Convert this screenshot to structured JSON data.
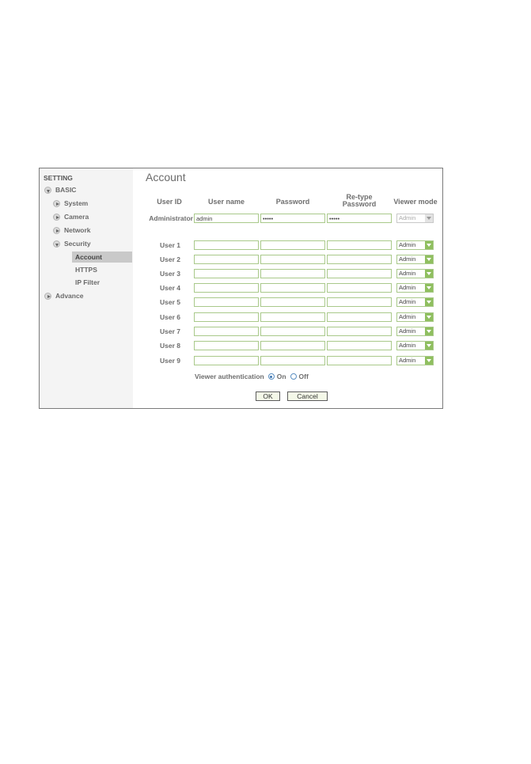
{
  "sidebar": {
    "title": "SETTING",
    "items": [
      {
        "label": "BASIC"
      },
      {
        "label": "System"
      },
      {
        "label": "Camera"
      },
      {
        "label": "Network"
      },
      {
        "label": "Security"
      },
      {
        "label": "Account"
      },
      {
        "label": "HTTPS"
      },
      {
        "label": "IP Filter"
      },
      {
        "label": "Advance"
      }
    ]
  },
  "main": {
    "title": "Account",
    "headers": {
      "user_id": "User ID",
      "user_name": "User name",
      "password": "Password",
      "retype_line1": "Re-type",
      "retype_line2": "Password",
      "viewer_mode": "Viewer mode"
    },
    "admin": {
      "label": "Administrator",
      "user_name": "admin",
      "password": "•••••",
      "retype": "•••••",
      "viewer_mode": "Admin"
    },
    "users": [
      {
        "label": "User 1",
        "viewer_mode": "Admin"
      },
      {
        "label": "User 2",
        "viewer_mode": "Admin"
      },
      {
        "label": "User 3",
        "viewer_mode": "Admin"
      },
      {
        "label": "User 4",
        "viewer_mode": "Admin"
      },
      {
        "label": "User 5",
        "viewer_mode": "Admin"
      },
      {
        "label": "User 6",
        "viewer_mode": "Admin"
      },
      {
        "label": "User 7",
        "viewer_mode": "Admin"
      },
      {
        "label": "User 8",
        "viewer_mode": "Admin"
      },
      {
        "label": "User 9",
        "viewer_mode": "Admin"
      }
    ],
    "viewer_auth": {
      "label": "Viewer authentication",
      "on_label": "On",
      "off_label": "Off",
      "selected": "On"
    },
    "buttons": {
      "ok": "OK",
      "cancel": "Cancel"
    }
  },
  "colors": {
    "field_border": "#a9c98a",
    "select_button": "#8fbf5f",
    "active_nav_bg": "#c9c9c9"
  }
}
